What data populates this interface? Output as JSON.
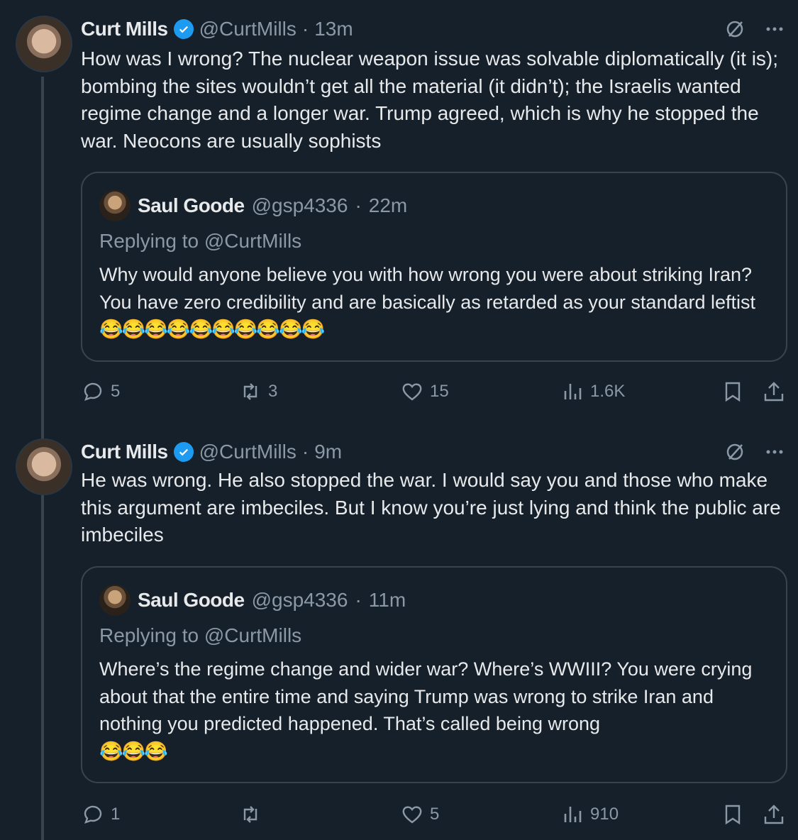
{
  "tweets": [
    {
      "author_name": "Curt Mills",
      "author_handle": "@CurtMills",
      "separator": "·",
      "time": "13m",
      "text": "How was I wrong? The nuclear weapon issue was solvable diplomatically (it is); bombing the sites wouldn’t get all the material (it didn’t); the Israelis wanted regime change and a longer war. Trump agreed, which is why he stopped the war. Neocons are usually sophists",
      "quote": {
        "author_name": "Saul Goode",
        "author_handle": "@gsp4336",
        "separator": "·",
        "time": "22m",
        "replying_to": "Replying to @CurtMills",
        "text": "Why would anyone believe you with how wrong you were about striking Iran?  You have zero credibility and are basically as retarded as your standard leftist ",
        "emojis": "😂😂😂😂😂😂😂😂😂😂"
      },
      "actions": {
        "replies": "5",
        "reposts": "3",
        "likes": "15",
        "views": "1.6K"
      }
    },
    {
      "author_name": "Curt Mills",
      "author_handle": "@CurtMills",
      "separator": "·",
      "time": "9m",
      "text": "He was wrong. He also stopped the war. I would say you and those who make this argument are imbeciles. But I know you’re just lying and think the public are imbeciles",
      "quote": {
        "author_name": "Saul Goode",
        "author_handle": "@gsp4336",
        "separator": "·",
        "time": "11m",
        "replying_to": "Replying to @CurtMills",
        "text": "Where’s the regime change and wider war?  Where’s WWIII?  You were crying about that the entire time and saying Trump was wrong to strike Iran and nothing you predicted happened.  That’s called being wrong ",
        "emojis": "😂😂😂"
      },
      "actions": {
        "replies": "1",
        "reposts": "",
        "likes": "5",
        "views": "910"
      }
    }
  ],
  "icons": [
    "verified-badge-icon",
    "grok-icon",
    "more-icon",
    "reply-icon",
    "repost-icon",
    "like-icon",
    "views-icon",
    "bookmark-icon",
    "share-icon"
  ],
  "colors": {
    "background": "#15202b",
    "text": "#e7e9ea",
    "secondary": "#8b98a5",
    "border": "#38444d",
    "verified": "#1d9bf0"
  }
}
